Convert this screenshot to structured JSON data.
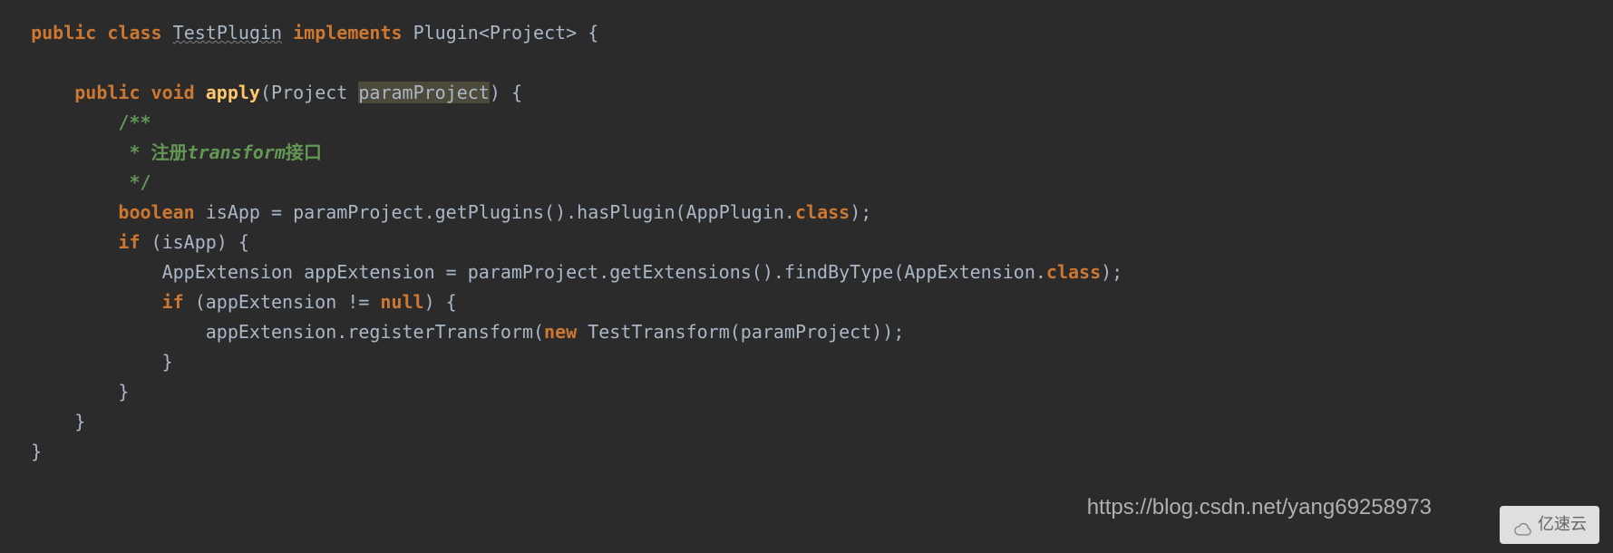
{
  "code": {
    "line1": {
      "kw_public": "public",
      "kw_class": "class",
      "classname": "TestPlugin",
      "kw_implements": "implements",
      "type_plugin": "Plugin<Project>",
      "brace": " {"
    },
    "line2": {
      "kw_public": "public",
      "kw_void": "void",
      "method": "apply",
      "paren_open": "(",
      "param_type": "Project ",
      "param_name": "paramProject",
      "paren_close": ")",
      "brace": " {"
    },
    "comment_open": "/**",
    "comment_body": " * 注册",
    "comment_transform": "transform",
    "comment_body2": "接口",
    "comment_close": " */",
    "line_bool": {
      "kw_boolean": "boolean",
      "var": " isApp = paramProject.getPlugins().hasPlugin(AppPlugin.",
      "kw_class": "class",
      "end": ");"
    },
    "line_if": {
      "kw_if": "if",
      "cond": " (isApp) {"
    },
    "line_ext": {
      "pre": "AppExtension appExtension = paramProject.getExtensions().findByType(AppExtension.",
      "kw_class": "class",
      "end": ");"
    },
    "line_if2": {
      "kw_if": "if",
      "cond_pre": " (appExtension != ",
      "kw_null": "null",
      "cond_post": ") {"
    },
    "line_reg": {
      "pre": "appExtension.registerTransform(",
      "kw_new": "new",
      "post": " TestTransform(paramProject));"
    },
    "brace_close": "}"
  },
  "watermark": {
    "url": "https://blog.csdn.net/yang69258973",
    "logo_text": "亿速云"
  }
}
